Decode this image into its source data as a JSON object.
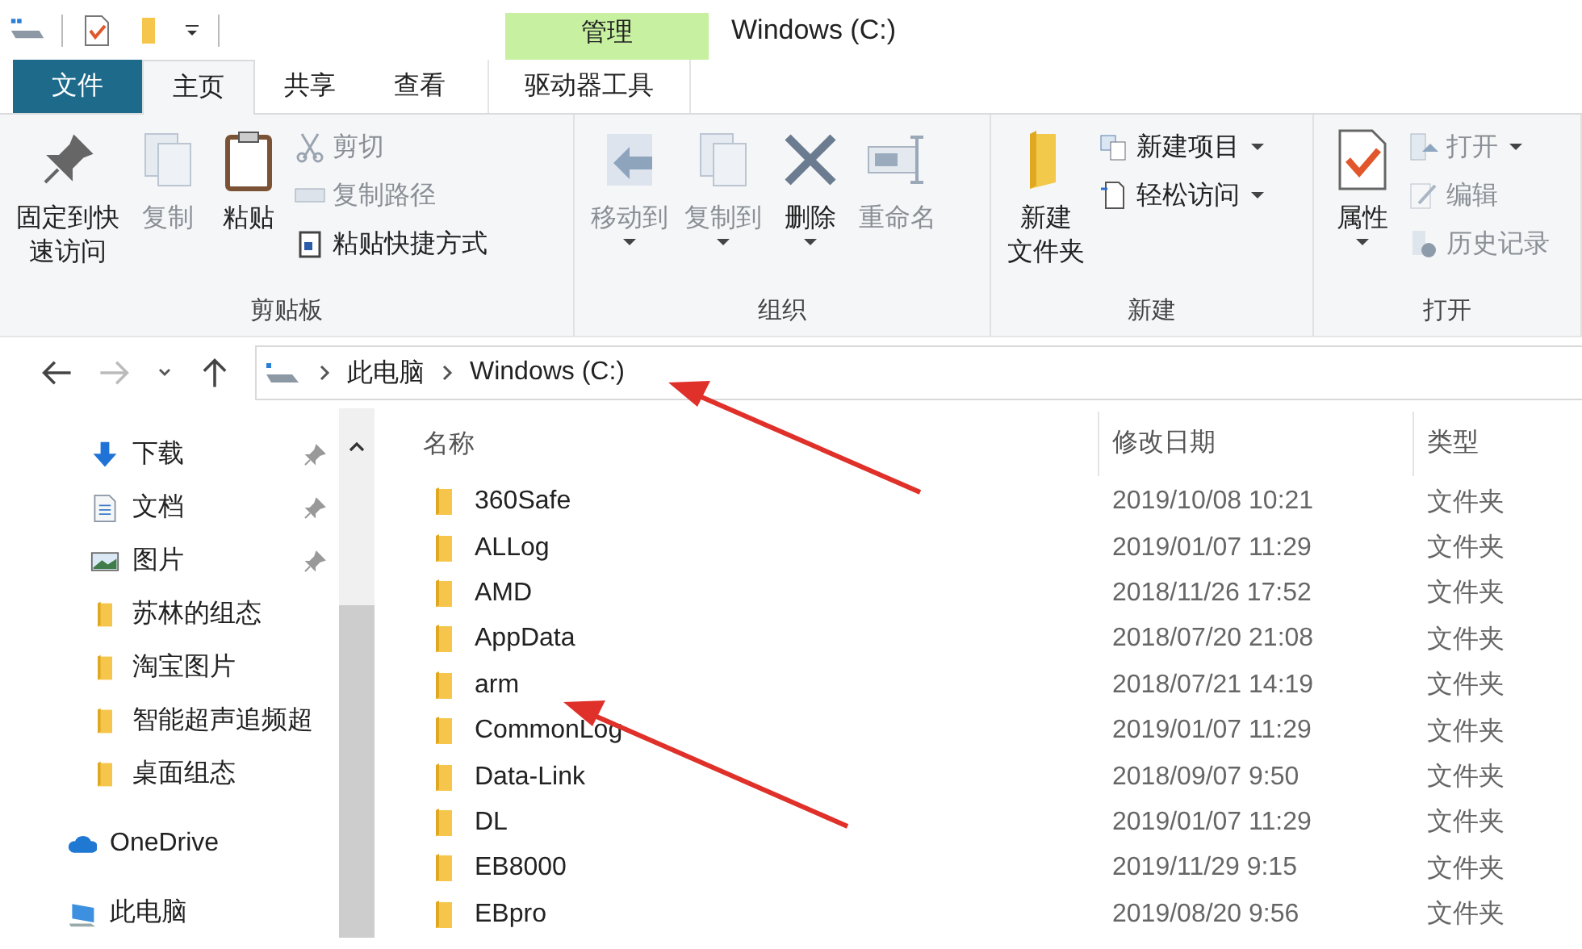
{
  "window": {
    "title": "Windows (C:)",
    "contextual_group": "管理"
  },
  "tabs": [
    {
      "label": "文件",
      "kind": "file",
      "selected": false
    },
    {
      "label": "主页",
      "kind": "normal",
      "selected": true
    },
    {
      "label": "共享",
      "kind": "normal",
      "selected": false
    },
    {
      "label": "查看",
      "kind": "normal",
      "selected": false
    },
    {
      "label": "驱动器工具",
      "kind": "contextual",
      "selected": false
    }
  ],
  "ribbon_groups": [
    {
      "label": "剪贴板",
      "buttons": [
        {
          "label_lines": [
            "固定到快",
            "速访问"
          ],
          "kind": "large",
          "disabled": false,
          "dropdown": false
        },
        {
          "label": "复制",
          "kind": "large",
          "disabled": true,
          "dropdown": false
        },
        {
          "label": "粘贴",
          "kind": "large",
          "disabled": false,
          "dropdown": false
        },
        {
          "label": "剪切",
          "kind": "small",
          "disabled": true,
          "dropdown": false
        },
        {
          "label": "复制路径",
          "kind": "small",
          "disabled": true,
          "dropdown": false
        },
        {
          "label": "粘贴快捷方式",
          "kind": "small",
          "disabled": false,
          "dropdown": false
        }
      ]
    },
    {
      "label": "组织",
      "buttons": [
        {
          "label": "移动到",
          "kind": "large",
          "disabled": true,
          "dropdown": true
        },
        {
          "label": "复制到",
          "kind": "large",
          "disabled": true,
          "dropdown": true
        },
        {
          "label": "删除",
          "kind": "large",
          "disabled": false,
          "dropdown": true
        },
        {
          "label": "重命名",
          "kind": "large",
          "disabled": true,
          "dropdown": false
        }
      ]
    },
    {
      "label": "新建",
      "buttons": [
        {
          "label_lines": [
            "新建",
            "文件夹"
          ],
          "kind": "large",
          "disabled": false,
          "dropdown": false
        },
        {
          "label": "新建项目",
          "kind": "small",
          "disabled": false,
          "dropdown": true
        },
        {
          "label": "轻松访问",
          "kind": "small",
          "disabled": false,
          "dropdown": true
        }
      ]
    },
    {
      "label": "打开",
      "buttons": [
        {
          "label": "属性",
          "kind": "large",
          "disabled": false,
          "dropdown": true
        },
        {
          "label": "打开",
          "kind": "small",
          "disabled": true,
          "dropdown": true
        },
        {
          "label": "编辑",
          "kind": "small",
          "disabled": true,
          "dropdown": false
        },
        {
          "label": "历史记录",
          "kind": "small",
          "disabled": true,
          "dropdown": false
        }
      ]
    }
  ],
  "address_bar": {
    "breadcrumb": [
      "此电脑",
      "Windows (C:)"
    ]
  },
  "nav_pane": {
    "items": [
      {
        "label": "下载",
        "kind": "download",
        "pinned": true
      },
      {
        "label": "文档",
        "kind": "document",
        "pinned": true
      },
      {
        "label": "图片",
        "kind": "picture",
        "pinned": true
      },
      {
        "label": "苏林的组态",
        "kind": "folder",
        "pinned": false
      },
      {
        "label": "淘宝图片",
        "kind": "folder",
        "pinned": false
      },
      {
        "label": "智能超声追频超",
        "kind": "folder",
        "pinned": false
      },
      {
        "label": "桌面组态",
        "kind": "folder",
        "pinned": false
      },
      {
        "label": "OneDrive",
        "kind": "cloud",
        "pinned": false
      },
      {
        "label": "此电脑",
        "kind": "pc",
        "pinned": false
      }
    ]
  },
  "file_list": {
    "columns": [
      "名称",
      "修改日期",
      "类型"
    ],
    "rows": [
      {
        "name": "360Safe",
        "modified": "2019/10/08 10:21",
        "type": "文件夹"
      },
      {
        "name": "ALLog",
        "modified": "2019/01/07 11:29",
        "type": "文件夹"
      },
      {
        "name": "AMD",
        "modified": "2018/11/26 17:52",
        "type": "文件夹"
      },
      {
        "name": "AppData",
        "modified": "2018/07/20 21:08",
        "type": "文件夹"
      },
      {
        "name": "arm",
        "modified": "2018/07/21 14:19",
        "type": "文件夹"
      },
      {
        "name": "CommonLog",
        "modified": "2019/01/07 11:29",
        "type": "文件夹"
      },
      {
        "name": "Data-Link",
        "modified": "2018/09/07 9:50",
        "type": "文件夹"
      },
      {
        "name": "DL",
        "modified": "2019/01/07 11:29",
        "type": "文件夹"
      },
      {
        "name": "EB8000",
        "modified": "2019/11/29 9:15",
        "type": "文件夹"
      },
      {
        "name": "EBpro",
        "modified": "2019/08/20 9:56",
        "type": "文件夹"
      }
    ]
  }
}
